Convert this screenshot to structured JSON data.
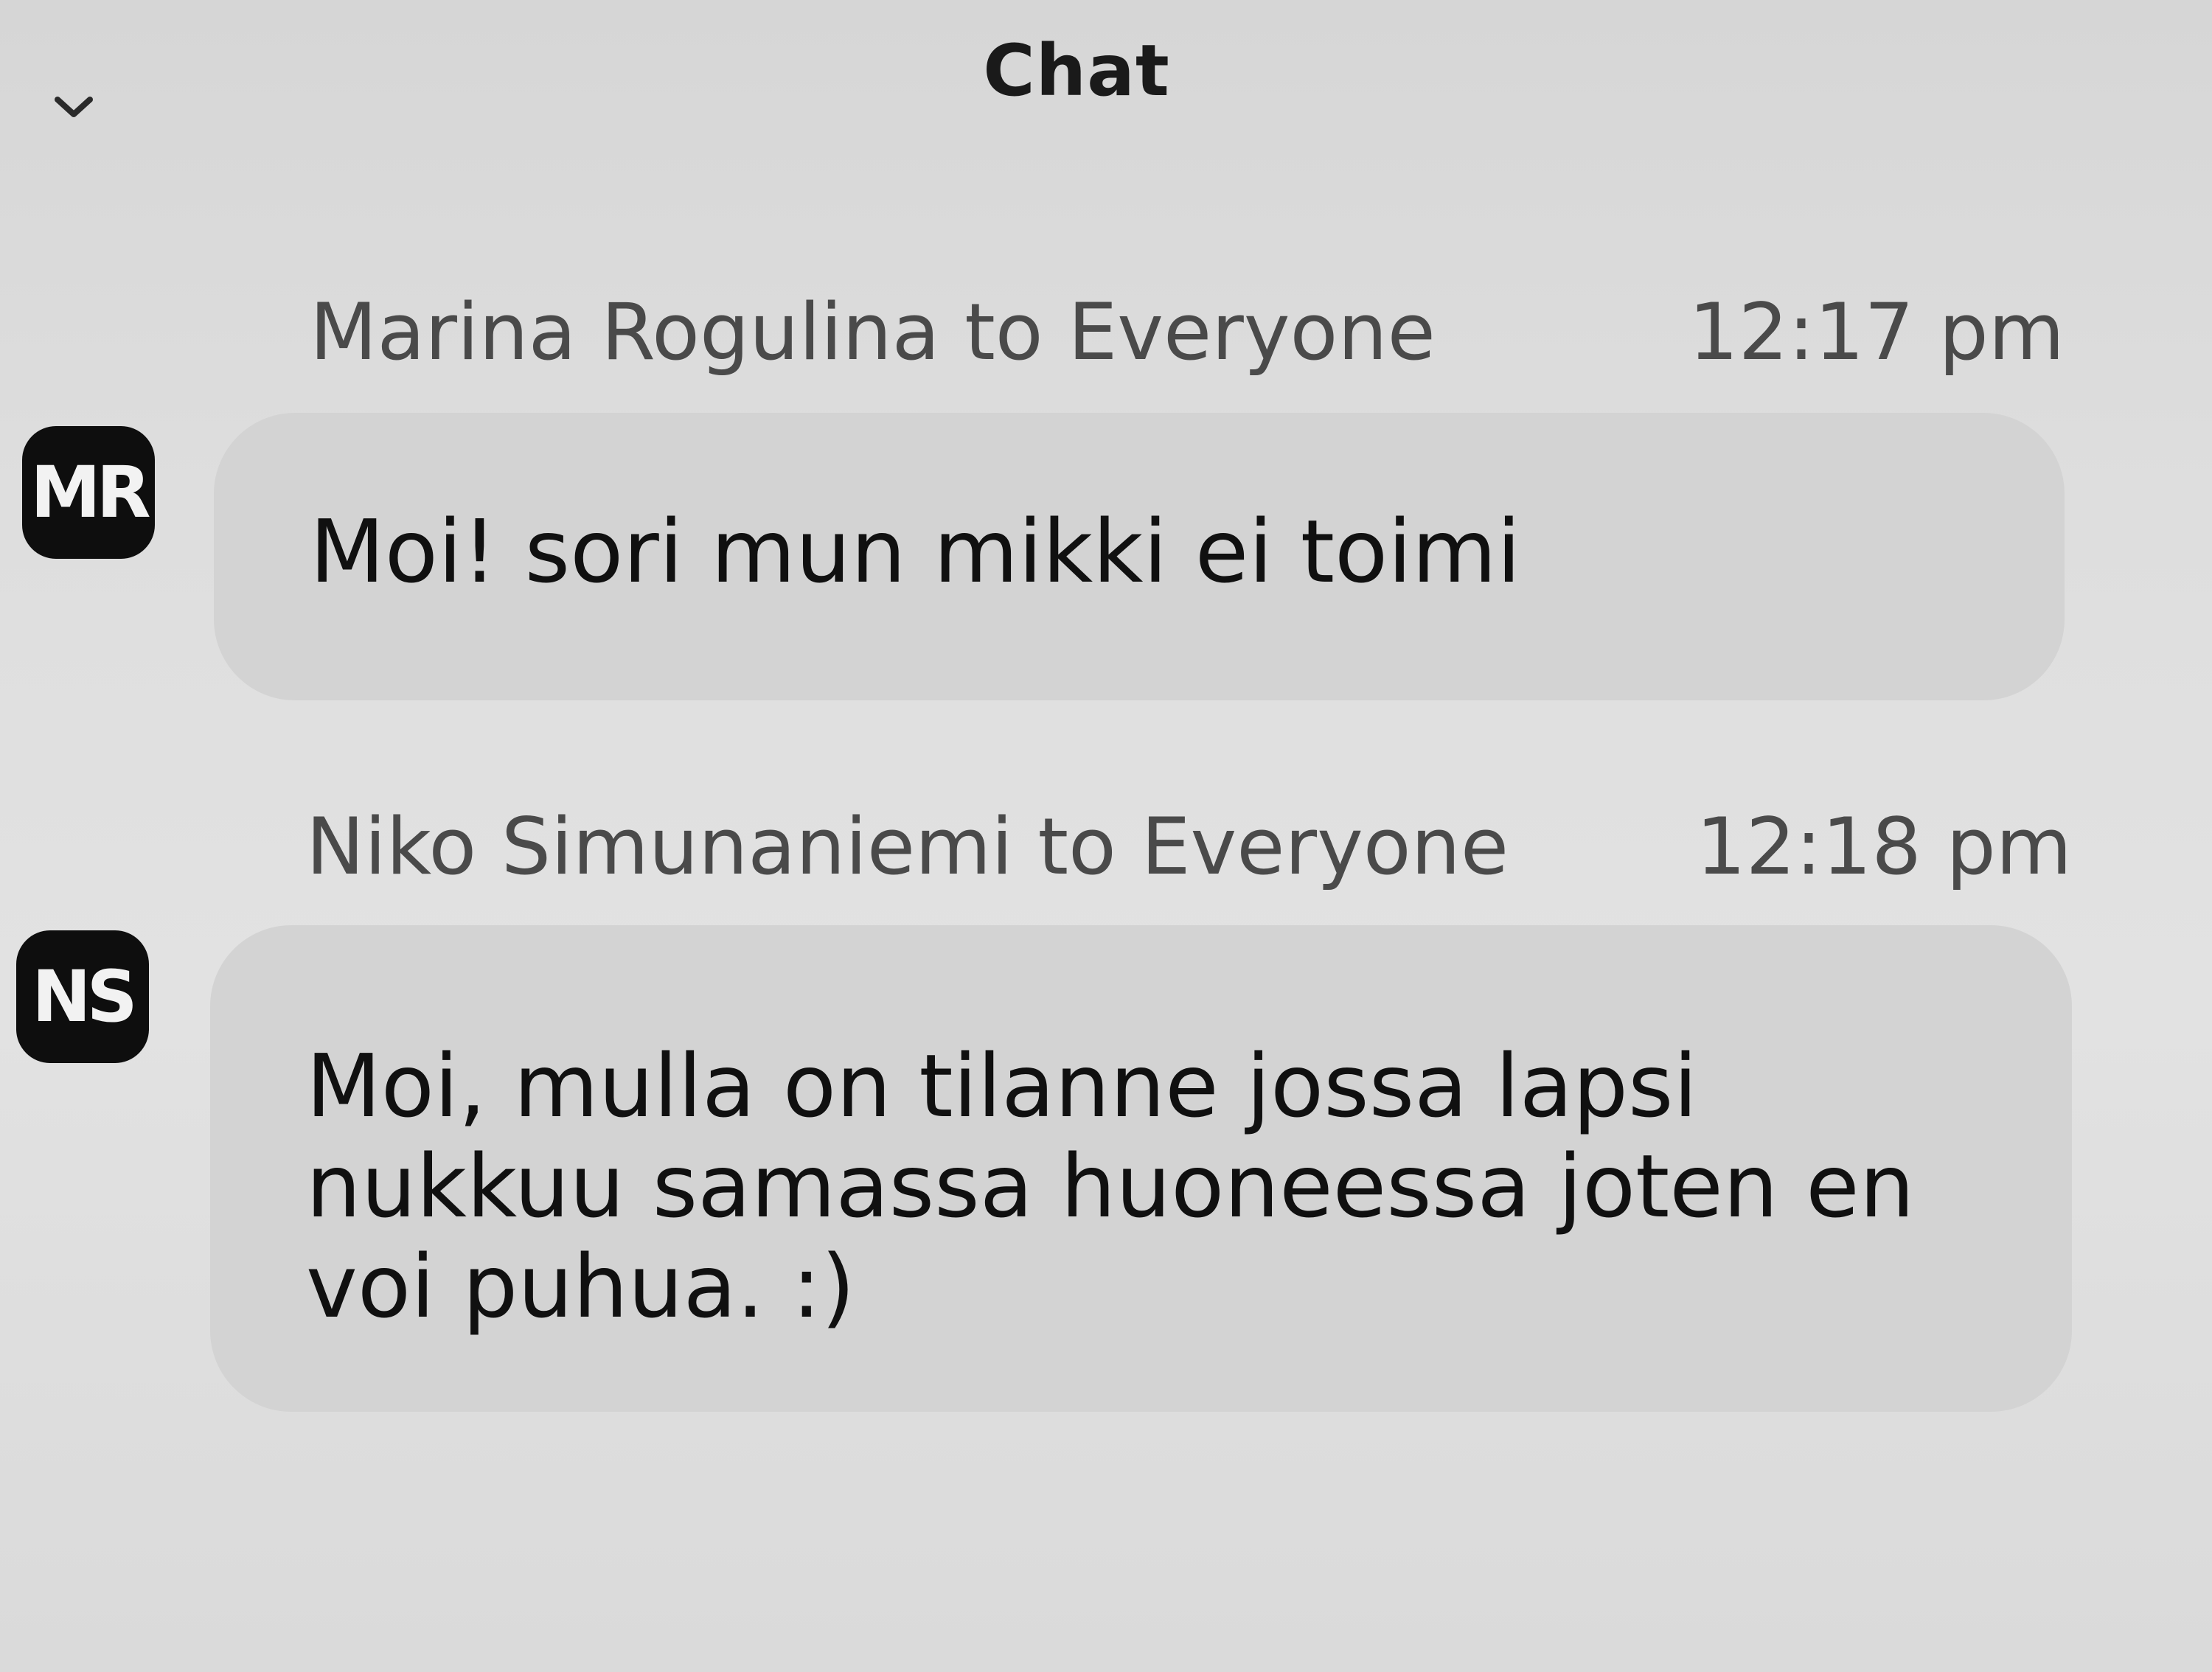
{
  "header": {
    "title": "Chat",
    "collapse_icon": "chevron-down-icon"
  },
  "messages": [
    {
      "initials": "MR",
      "sender": "Marina Rogulina to Everyone",
      "time": "12:17 pm",
      "text": "Moi! sori mun mikki ei toimi"
    },
    {
      "initials": "NS",
      "sender": "Niko Simunaniemi to Everyone",
      "time": "12:18 pm",
      "text": "Moi, mulla on tilanne jossa lapsi\nnukkuu samassa huoneessa joten en\nvoi puhua. :)"
    }
  ],
  "colors": {
    "avatar_bg": "#0e0e0e",
    "bubble_bg": "#d3d3d3",
    "background": "#dcdcdc"
  }
}
